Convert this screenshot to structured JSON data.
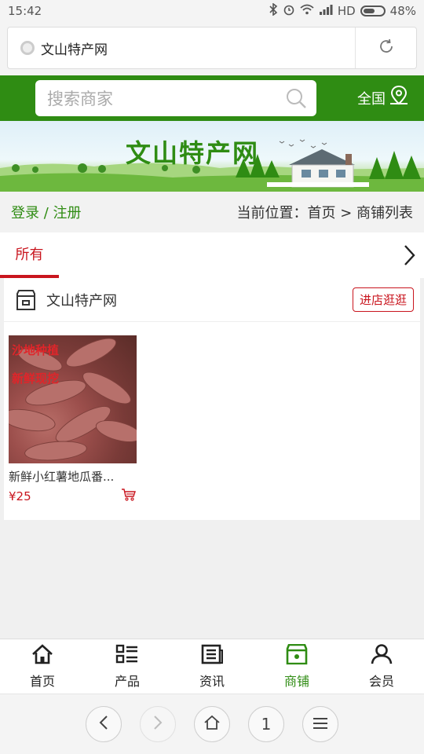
{
  "status_bar": {
    "time": "15:42",
    "network": "HD",
    "battery": "48%"
  },
  "browser": {
    "url_title": "文山特产网"
  },
  "header": {
    "search_placeholder": "搜索商家",
    "region_label": "全国"
  },
  "banner": {
    "title": "文山特产网"
  },
  "breadcrumb": {
    "login": "登录",
    "separator": " / ",
    "register": "注册",
    "prefix": "当前位置：",
    "home": "首页",
    "arrow": " > ",
    "current": "商铺列表"
  },
  "tabs": [
    {
      "label": "所有"
    }
  ],
  "shop": {
    "name": "文山特产网",
    "visit_label": "进店逛逛",
    "products": [
      {
        "image_text_1": "沙地种植",
        "image_text_2": "新鲜现挖",
        "name": "新鲜小红薯地瓜番...",
        "price": "¥25"
      }
    ]
  },
  "bottom_nav": [
    {
      "label": "首页",
      "icon": "home-icon"
    },
    {
      "label": "产品",
      "icon": "list-icon"
    },
    {
      "label": "资讯",
      "icon": "news-icon"
    },
    {
      "label": "商铺",
      "icon": "shop-icon"
    },
    {
      "label": "会员",
      "icon": "user-icon"
    }
  ],
  "browser_bar": {
    "tab_count": "1"
  },
  "colors": {
    "brand_green": "#2f8c13",
    "accent_red": "#c9151e"
  }
}
